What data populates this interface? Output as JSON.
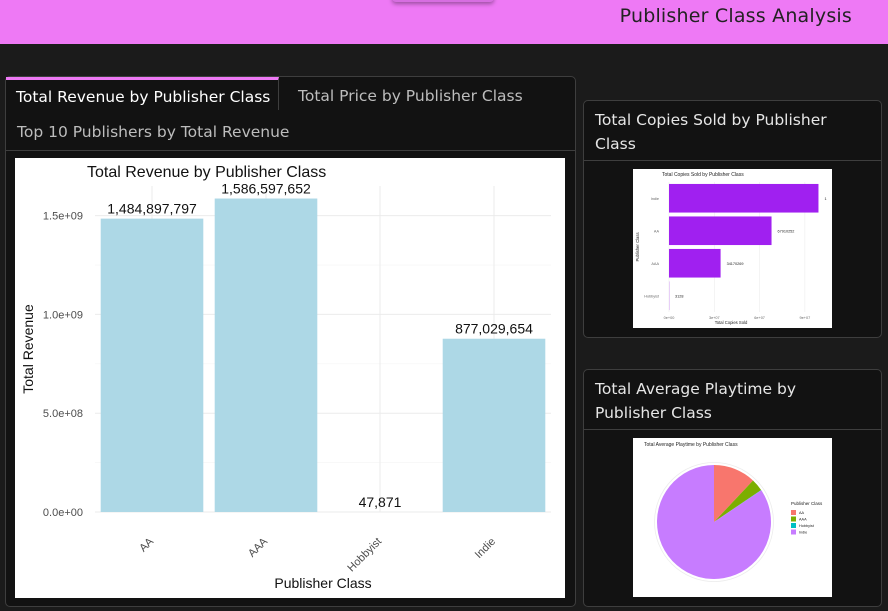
{
  "header": {
    "title": "Publisher Class Analysis"
  },
  "tabs": [
    {
      "label": "Total Revenue by Publisher Class"
    },
    {
      "label": "Total Price by Publisher Class"
    },
    {
      "label": "Top 10 Publishers by Total Revenue"
    }
  ],
  "cards": {
    "copies": {
      "title": "Total Copies Sold by Publisher Class"
    },
    "playtime": {
      "title": "Total Average Playtime by Publisher Class"
    }
  },
  "chart_data": [
    {
      "type": "bar",
      "title": "Total Revenue by Publisher Class",
      "xlabel": "Publisher Class",
      "ylabel": "Total Revenue",
      "categories": [
        "AA",
        "AAA",
        "Hobbyist",
        "Indie"
      ],
      "values": [
        1484897797,
        1586597652,
        47871,
        877029654
      ],
      "data_labels": [
        "1,484,897,797",
        "1,586,597,652",
        "47,871",
        "877,029,654"
      ],
      "y_ticks": [
        0,
        500000000,
        1000000000,
        1500000000
      ],
      "y_tick_labels": [
        "0.0e+00",
        "5.0e+08",
        "1.0e+09",
        "1.5e+09"
      ],
      "ylim": [
        0,
        1650000000
      ],
      "bar_color": "#add8e6",
      "grid": true
    },
    {
      "type": "bar",
      "orientation": "horizontal",
      "title": "Total Copies Sold by Publisher Class",
      "xlabel": "Total Copies Sold",
      "ylabel": "Publisher Class",
      "categories": [
        "Indie",
        "AA",
        "AAA",
        "Hobbyist"
      ],
      "values": [
        99000000,
        67910252,
        34170269,
        3128
      ],
      "data_labels": [
        "1",
        "67910252",
        "34170269",
        "3128"
      ],
      "x_tick_labels": [
        "0e+00",
        "3e+07",
        "6e+07",
        "9e+07"
      ],
      "bar_color": "#a020f0"
    },
    {
      "type": "pie",
      "title": "Total Average Playtime by Publisher Class",
      "legend_title": "Publisher Class",
      "legend_position": "right",
      "categories": [
        "AA",
        "AAA",
        "Hobbyist",
        "Indie"
      ],
      "values": [
        12,
        3.5,
        0.1,
        84.4
      ],
      "colors": [
        "#f8766d",
        "#7cae00",
        "#00bfc4",
        "#c77cff"
      ]
    }
  ]
}
